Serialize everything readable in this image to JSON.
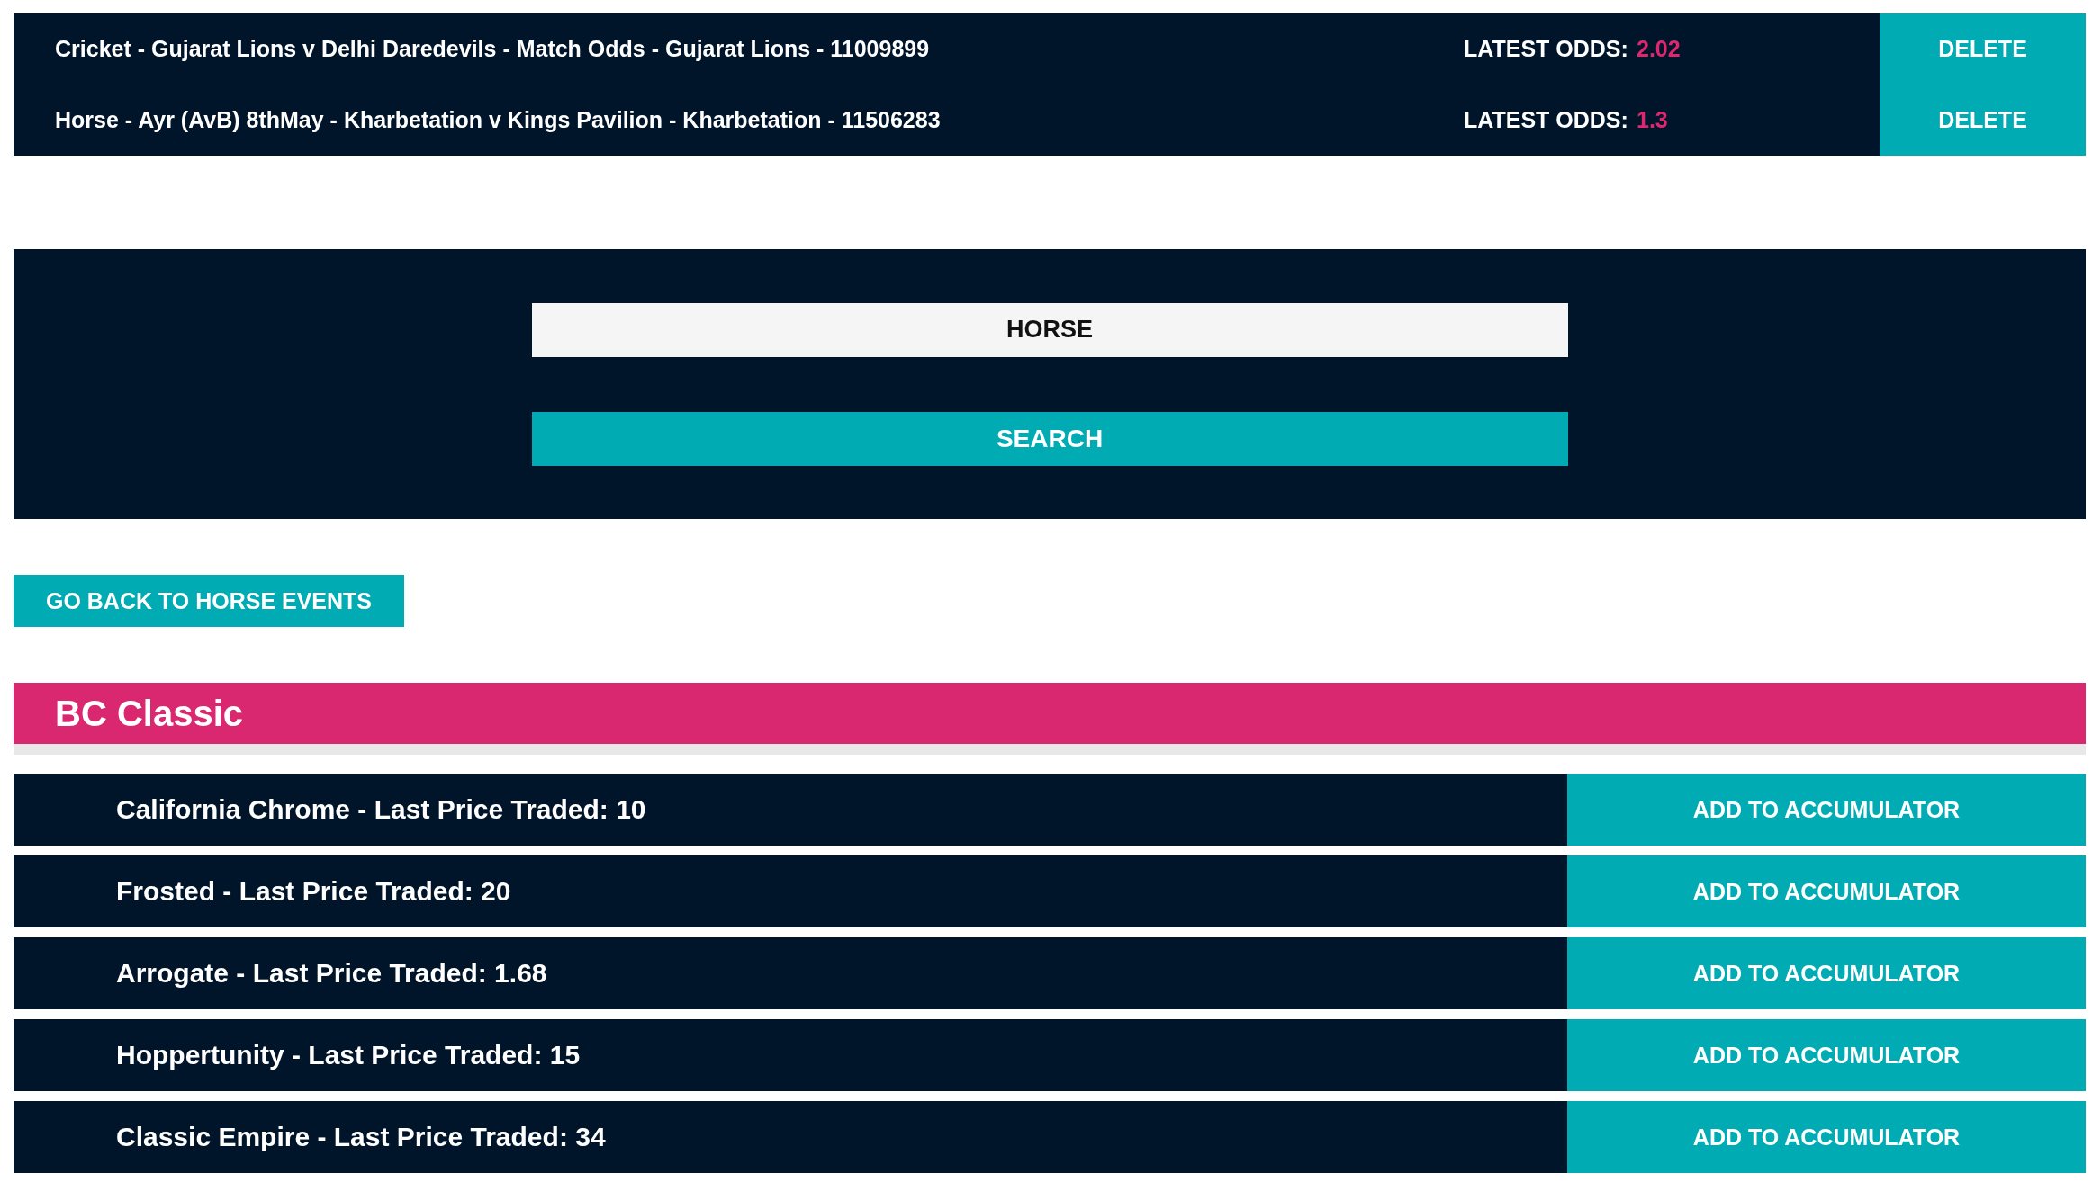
{
  "accumulator": {
    "items": [
      {
        "description": "Cricket - Gujarat Lions v Delhi Daredevils - Match Odds - Gujarat Lions - 11009899",
        "odds_label": "LATEST ODDS:",
        "odds": "2.02",
        "button": "DELETE"
      },
      {
        "description": "Horse - Ayr (AvB) 8thMay - Kharbetation v Kings Pavilion - Kharbetation - 11506283",
        "odds_label": "LATEST ODDS:",
        "odds": "1.3",
        "button": "DELETE"
      }
    ]
  },
  "search": {
    "value": "HORSE",
    "button": "SEARCH"
  },
  "back_button": "GO BACK TO HORSE EVENTS",
  "event": {
    "title": "BC Classic",
    "runners": [
      {
        "label": "California Chrome - Last Price Traded: 10",
        "button": "ADD TO ACCUMULATOR"
      },
      {
        "label": "Frosted - Last Price Traded: 20",
        "button": "ADD TO ACCUMULATOR"
      },
      {
        "label": "Arrogate - Last Price Traded: 1.68",
        "button": "ADD TO ACCUMULATOR"
      },
      {
        "label": "Hoppertunity - Last Price Traded: 15",
        "button": "ADD TO ACCUMULATOR"
      },
      {
        "label": "Classic Empire - Last Price Traded: 34",
        "button": "ADD TO ACCUMULATOR"
      }
    ]
  }
}
